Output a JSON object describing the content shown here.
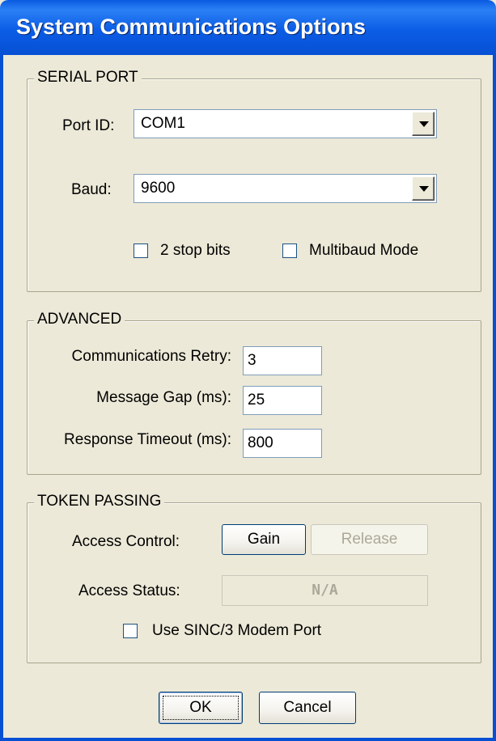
{
  "window": {
    "title": "System Communications Options"
  },
  "serial_port": {
    "group_label": "SERIAL PORT",
    "port_id": {
      "label": "Port ID:",
      "value": "COM1"
    },
    "baud": {
      "label": "Baud:",
      "value": "9600"
    },
    "two_stop_bits": {
      "label": "2 stop bits",
      "checked": false
    },
    "multibaud_mode": {
      "label": "Multibaud Mode",
      "checked": false
    }
  },
  "advanced": {
    "group_label": "ADVANCED",
    "comm_retry": {
      "label": "Communications Retry:",
      "value": "3"
    },
    "message_gap": {
      "label": "Message Gap (ms):",
      "value": "25"
    },
    "response_timeout": {
      "label": "Response Timeout (ms):",
      "value": "800"
    }
  },
  "token_passing": {
    "group_label": "TOKEN PASSING",
    "access_control_label": "Access Control:",
    "gain_label": "Gain",
    "release_label": "Release",
    "access_status_label": "Access Status:",
    "access_status_value": "N/A",
    "modem_port": {
      "label": "Use SINC/3 Modem Port",
      "checked": false
    }
  },
  "footer": {
    "ok_label": "OK",
    "cancel_label": "Cancel"
  },
  "colors": {
    "titlebar": "#0A5BE0",
    "dialog_bg": "#ECE9D8",
    "group_border": "#A8A48C",
    "input_border": "#7F9DB9",
    "disabled_text": "#ACA899"
  }
}
